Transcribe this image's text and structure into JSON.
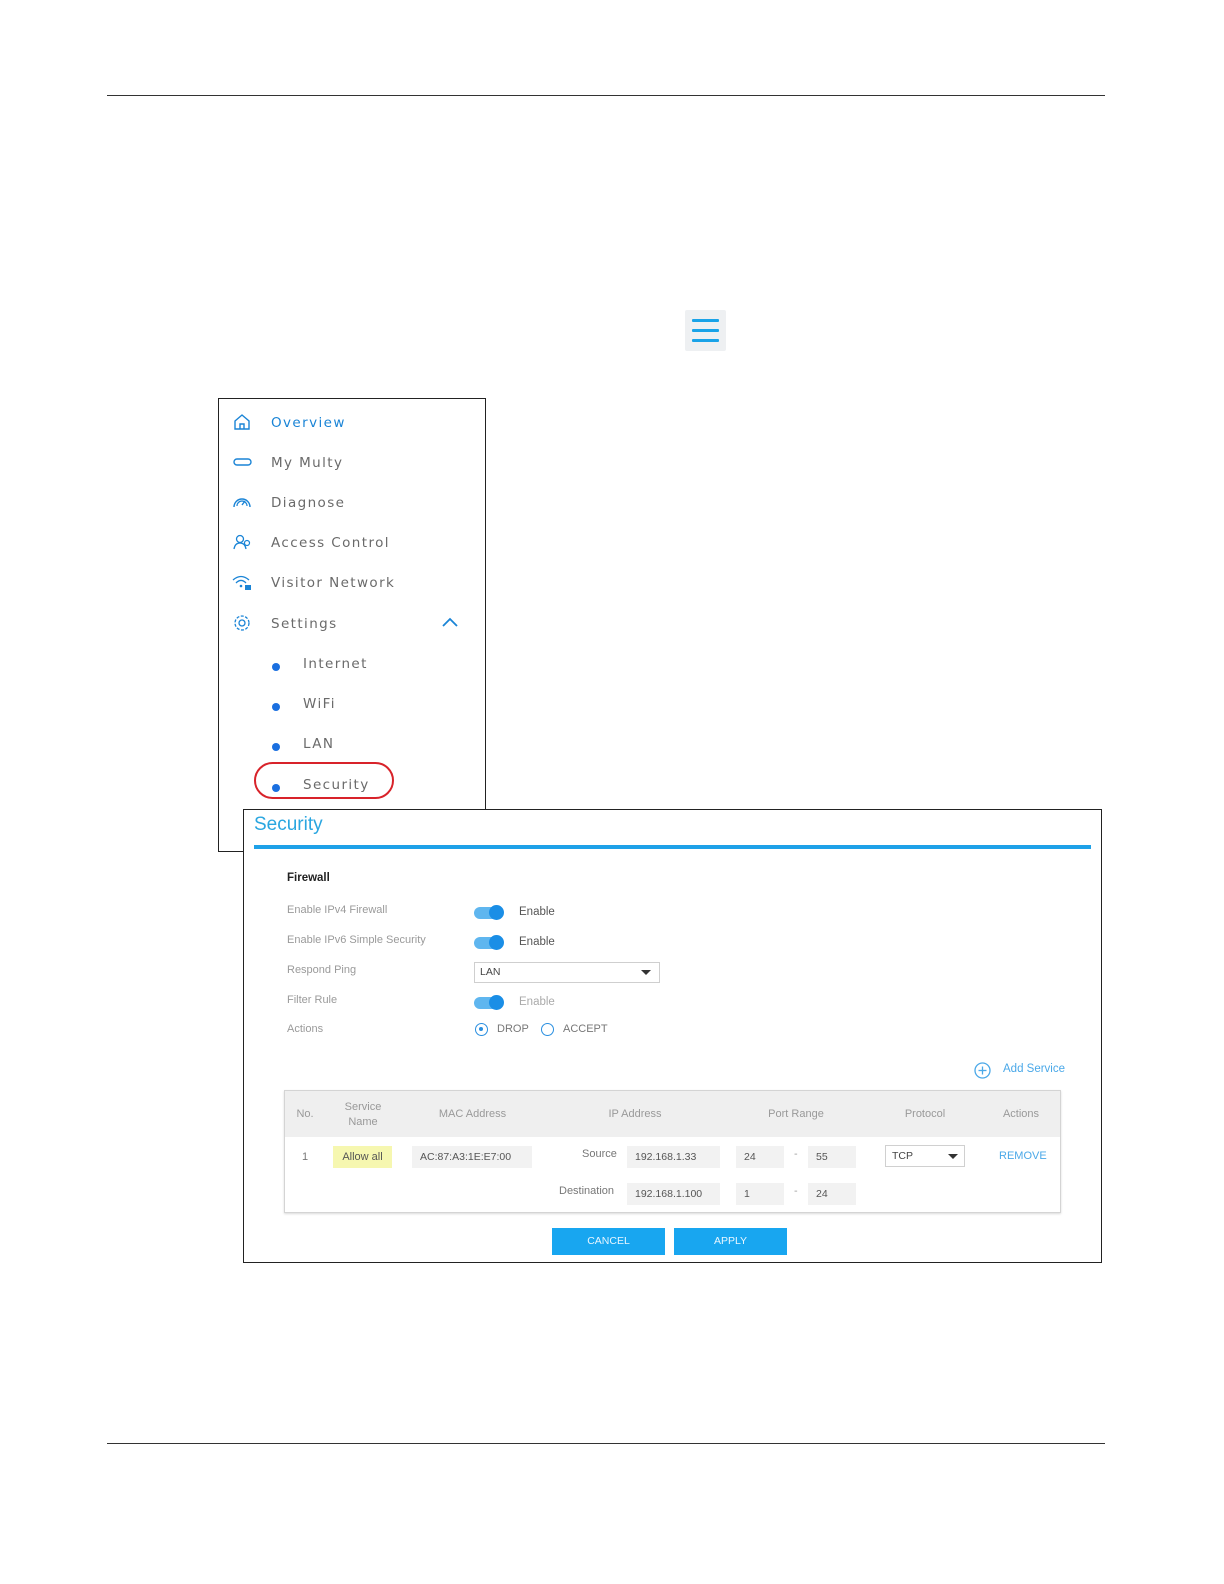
{
  "menu": {
    "items": [
      {
        "label": "Overview",
        "icon": "home-icon"
      },
      {
        "label": "My Multy",
        "icon": "device-icon"
      },
      {
        "label": "Diagnose",
        "icon": "speedometer-icon"
      },
      {
        "label": "Access Control",
        "icon": "users-icon"
      },
      {
        "label": "Visitor Network",
        "icon": "wifi-lock-icon"
      },
      {
        "label": "Settings",
        "icon": "gear-icon"
      }
    ],
    "sub_items": [
      "Internet",
      "WiFi",
      "LAN",
      "Security"
    ]
  },
  "security": {
    "title": "Security",
    "section": "Firewall",
    "rows": {
      "ipv4_label": "Enable IPv4 Firewall",
      "ipv4_toggle": "Enable",
      "ipv6_label": "Enable IPv6 Simple Security",
      "ipv6_toggle": "Enable",
      "ping_label": "Respond Ping",
      "ping_value": "LAN",
      "filter_label": "Filter Rule",
      "filter_toggle": "Enable",
      "actions_label": "Actions",
      "action_drop": "DROP",
      "action_accept": "ACCEPT"
    },
    "add_service": "Add Service",
    "table": {
      "headers": {
        "no": "No.",
        "service_1": "Service",
        "service_2": "Name",
        "mac": "MAC Address",
        "ip": "IP Address",
        "port": "Port Range",
        "protocol": "Protocol",
        "actions": "Actions"
      },
      "row": {
        "no": "1",
        "service": "Allow all",
        "mac": "AC:87:A3:1E:E7:00",
        "source_label": "Source",
        "source_ip": "192.168.1.33",
        "source_port_from": "24",
        "source_port_to": "55",
        "dest_label": "Destination",
        "dest_ip": "192.168.1.100",
        "dest_port_from": "1",
        "dest_port_to": "24",
        "protocol": "TCP",
        "remove": "REMOVE"
      }
    },
    "buttons": {
      "cancel": "CANCEL",
      "apply": "APPLY"
    }
  },
  "colors": {
    "accent": "#1ea1e8",
    "menu_active": "#1a84d6",
    "highlight": "#d8232a"
  }
}
